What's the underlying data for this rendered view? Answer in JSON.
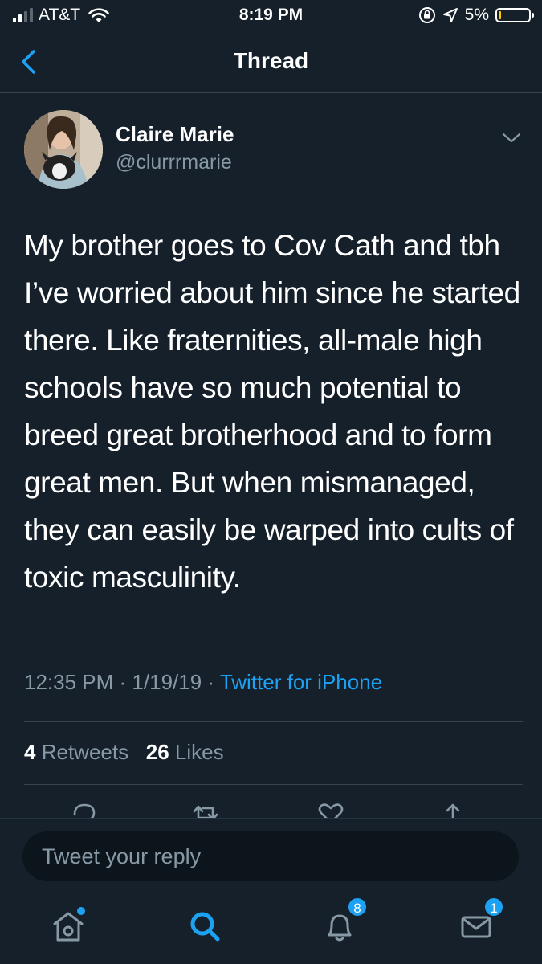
{
  "status_bar": {
    "carrier": "AT&T",
    "time": "8:19 PM",
    "battery": "5%",
    "battery_level": 0.05
  },
  "header": {
    "title": "Thread"
  },
  "tweet": {
    "author_name": "Claire Marie",
    "author_handle": "@clurrrmarie",
    "text": "My brother goes to Cov Cath and tbh I’ve worried about him since he started there. Like fraternities, all-male high schools have so much potential to breed great brotherhood and to form great men. But when mismanaged, they can easily be warped into cults of toxic masculinity.",
    "time": "12:35 PM",
    "date": "1/19/19",
    "source": "Twitter for iPhone",
    "retweets_count": "4",
    "retweets_label": "Retweets",
    "likes_count": "26",
    "likes_label": "Likes"
  },
  "reply": {
    "placeholder": "Tweet your reply"
  },
  "tabs": {
    "notifications_badge": "8",
    "messages_badge": "1"
  },
  "colors": {
    "background": "#15202b",
    "accent": "#1da1f2",
    "secondary_text": "#8899a6",
    "divider": "#38444d"
  }
}
